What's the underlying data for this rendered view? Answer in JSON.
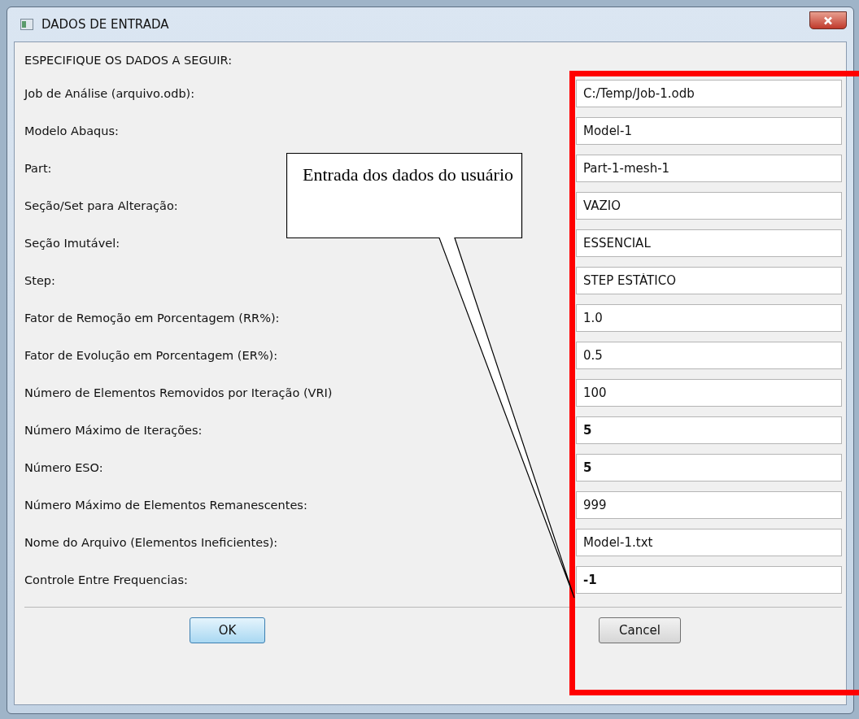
{
  "window": {
    "title": "DADOS DE ENTRADA"
  },
  "heading": "ESPECIFIQUE OS DADOS A SEGUIR:",
  "fields": [
    {
      "label": "Job de Análise (arquivo.odb):",
      "value": "C:/Temp/Job-1.odb",
      "bold": false
    },
    {
      "label": "Modelo Abaqus:",
      "value": "Model-1",
      "bold": false
    },
    {
      "label": "Part:",
      "value": "Part-1-mesh-1",
      "bold": false
    },
    {
      "label": "Seção/Set para Alteração:",
      "value": "VAZIO",
      "bold": false
    },
    {
      "label": "Seção Imutável:",
      "value": "ESSENCIAL",
      "bold": false
    },
    {
      "label": "Step:",
      "value": "STEP ESTÁTICO",
      "bold": false
    },
    {
      "label": "Fator de Remoção em Porcentagem (RR%):",
      "value": "1.0",
      "bold": false
    },
    {
      "label": "Fator de Evolução em Porcentagem (ER%):",
      "value": "0.5",
      "bold": false
    },
    {
      "label": "Número de Elementos Removidos por Iteração (VRI)",
      "value": "100",
      "bold": false
    },
    {
      "label": "Número Máximo de Iterações:",
      "value": "5",
      "bold": true
    },
    {
      "label": "Número ESO:",
      "value": "5",
      "bold": true
    },
    {
      "label": "Número Máximo de Elementos Remanescentes:",
      "value": "999",
      "bold": false
    },
    {
      "label": "Nome do Arquivo (Elementos Ineficientes):",
      "value": "Model-1.txt",
      "bold": false
    },
    {
      "label": "Controle Entre Frequencias:",
      "value": "-1",
      "bold": true
    }
  ],
  "buttons": [
    "OK",
    "Cancel"
  ],
  "callout": {
    "text": "Entrada dos dados do usuário"
  }
}
